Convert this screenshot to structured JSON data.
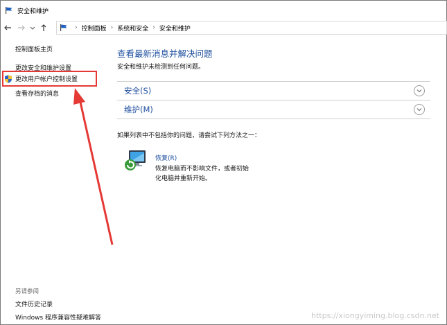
{
  "window": {
    "title": "安全和维护"
  },
  "address": {
    "crumbs": [
      "控制面板",
      "系统和安全",
      "安全和维护"
    ]
  },
  "left_pane": {
    "home_link": "控制面板主页",
    "links": [
      "更改安全和维护设置",
      "更改用户帐户控制设置",
      "查看存档的消息"
    ],
    "see_also_label": "另请参阅",
    "see_also_links": [
      "文件历史记录",
      "Windows 程序兼容性疑难解答"
    ]
  },
  "main": {
    "title": "查看最新消息并解决问题",
    "subtitle": "安全和维护未检测到任何问题。",
    "sections": [
      "安全(S)",
      "维护(M)"
    ],
    "hint": "如果列表中不包括你的问题，请尝试下列方法之一：",
    "recovery": {
      "link": "恢复(R)",
      "desc_line1": "恢复电脑而不影响文件，或者初始",
      "desc_line2": "化电脑并重新开始。"
    }
  },
  "watermark": "https://xiongyiming.blog.csdn.net",
  "colors": {
    "accent": "#1e4e9e",
    "highlight": "#e53935",
    "arrow": "#e53935"
  }
}
